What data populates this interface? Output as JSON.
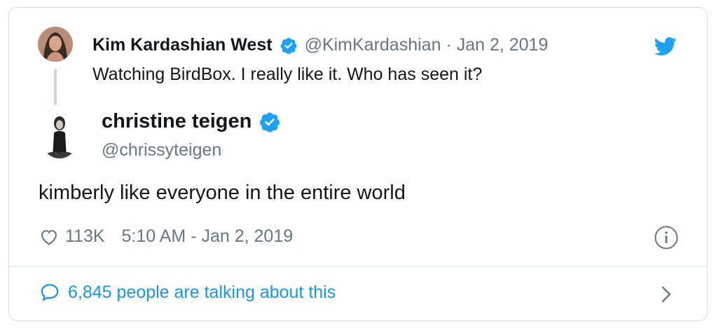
{
  "quoted_tweet": {
    "author_name": "Kim Kardashian West",
    "handle_date": "@KimKardashian · Jan 2, 2019",
    "text": "Watching BirdBox. I really like it. Who has seen it?"
  },
  "tweet": {
    "author_name": "christine teigen",
    "handle": "@chrissyteigen",
    "text": "kimberly like everyone in the entire world",
    "likes": "113K",
    "timestamp": "5:10 AM - Jan 2, 2019"
  },
  "footer": {
    "talking_label": "6,845 people are talking about this"
  },
  "colors": {
    "twitter_blue": "#1da1f2",
    "link_blue": "#1b95e0",
    "secondary_text": "#657786"
  },
  "icons": [
    "verified-badge-icon",
    "twitter-bird-icon",
    "heart-icon",
    "info-icon",
    "speech-bubble-icon",
    "chevron-right-icon"
  ]
}
